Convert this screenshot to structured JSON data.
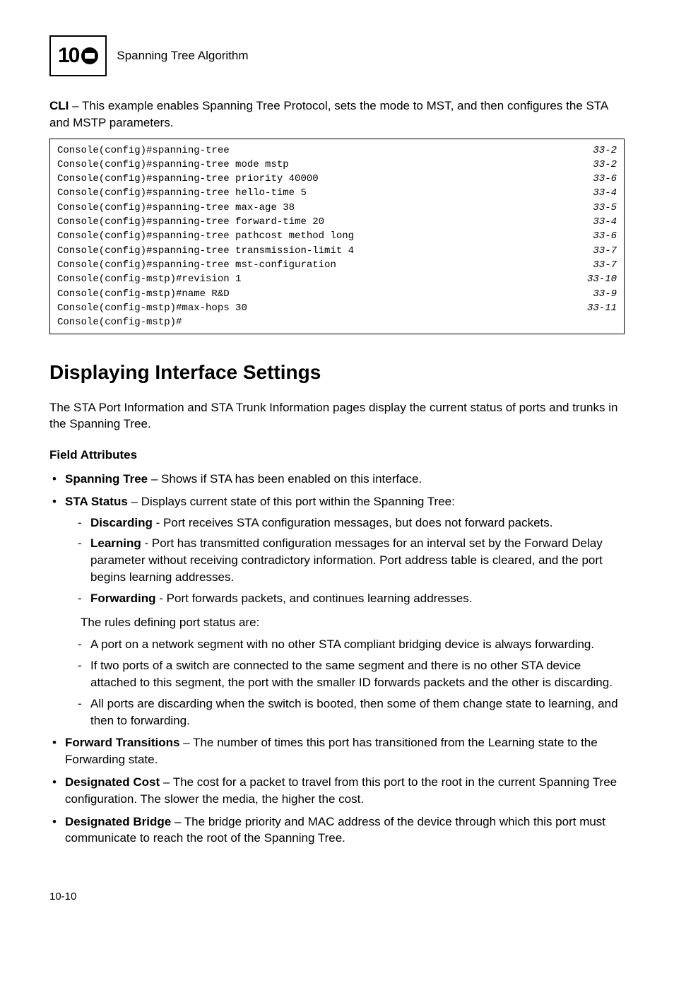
{
  "header": {
    "chapter": "10",
    "title": "Spanning Tree Algorithm"
  },
  "cli_intro_label": "CLI",
  "cli_intro_text": " – This example enables Spanning Tree Protocol, sets the mode to MST, and then configures the STA and MSTP parameters.",
  "code_lines": [
    {
      "cmd": "Console(config)#spanning-tree",
      "ref": "33-2"
    },
    {
      "cmd": "Console(config)#spanning-tree mode mstp",
      "ref": "33-2"
    },
    {
      "cmd": "Console(config)#spanning-tree priority 40000",
      "ref": "33-6"
    },
    {
      "cmd": "Console(config)#spanning-tree hello-time 5",
      "ref": "33-4"
    },
    {
      "cmd": "Console(config)#spanning-tree max-age 38",
      "ref": "33-5"
    },
    {
      "cmd": "Console(config)#spanning-tree forward-time 20",
      "ref": "33-4"
    },
    {
      "cmd": "Console(config)#spanning-tree pathcost method long",
      "ref": "33-6"
    },
    {
      "cmd": "Console(config)#spanning-tree transmission-limit 4",
      "ref": "33-7"
    },
    {
      "cmd": "Console(config)#spanning-tree mst-configuration",
      "ref": "33-7"
    },
    {
      "cmd": "Console(config-mstp)#revision 1",
      "ref": "33-10"
    },
    {
      "cmd": "Console(config-mstp)#name R&D",
      "ref": "33-9"
    },
    {
      "cmd": "Console(config-mstp)#max-hops 30",
      "ref": "33-11"
    },
    {
      "cmd": "Console(config-mstp)#",
      "ref": ""
    }
  ],
  "section_heading": "Displaying Interface Settings",
  "section_intro": "The STA Port Information and STA Trunk Information pages display the current status of ports and trunks in the Spanning Tree.",
  "field_attr_heading": "Field Attributes",
  "bullets": {
    "spanning_tree_label": "Spanning Tree",
    "spanning_tree_text": " – Shows if STA has been enabled on this interface.",
    "sta_status_label": "STA Status",
    "sta_status_text": " – Displays current state of this port within the Spanning Tree:",
    "discarding_label": "Discarding",
    "discarding_text": " - Port receives STA configuration messages, but does not forward packets.",
    "learning_label": "Learning",
    "learning_text": " - Port has transmitted configuration messages for an interval set by the Forward Delay parameter without receiving contradictory information. Port address table is cleared, and the port begins learning addresses.",
    "forwarding_label": "Forwarding",
    "forwarding_text": " - Port forwards packets, and continues learning addresses.",
    "rules_intro": "The rules defining port status are:",
    "rule1": "A port on a network segment with no other STA compliant bridging device is always forwarding.",
    "rule2": "If two ports of a switch are connected to the same segment and there is no other STA device attached to this segment, the port with the smaller ID forwards packets and the other is discarding.",
    "rule3": "All ports are discarding when the switch is booted, then some of them change state to learning, and then to forwarding.",
    "fwd_trans_label": "Forward Transitions",
    "fwd_trans_text": " – The number of times this port has transitioned from the Learning state to the Forwarding state.",
    "des_cost_label": "Designated Cost",
    "des_cost_text": " – The cost for a packet to travel from this port to the root in the current Spanning Tree configuration. The slower the media, the higher the cost.",
    "des_bridge_label": "Designated Bridge",
    "des_bridge_text": " – The bridge priority and MAC address of the device through which this port must communicate to reach the root of the Spanning Tree."
  },
  "footer": "10-10"
}
